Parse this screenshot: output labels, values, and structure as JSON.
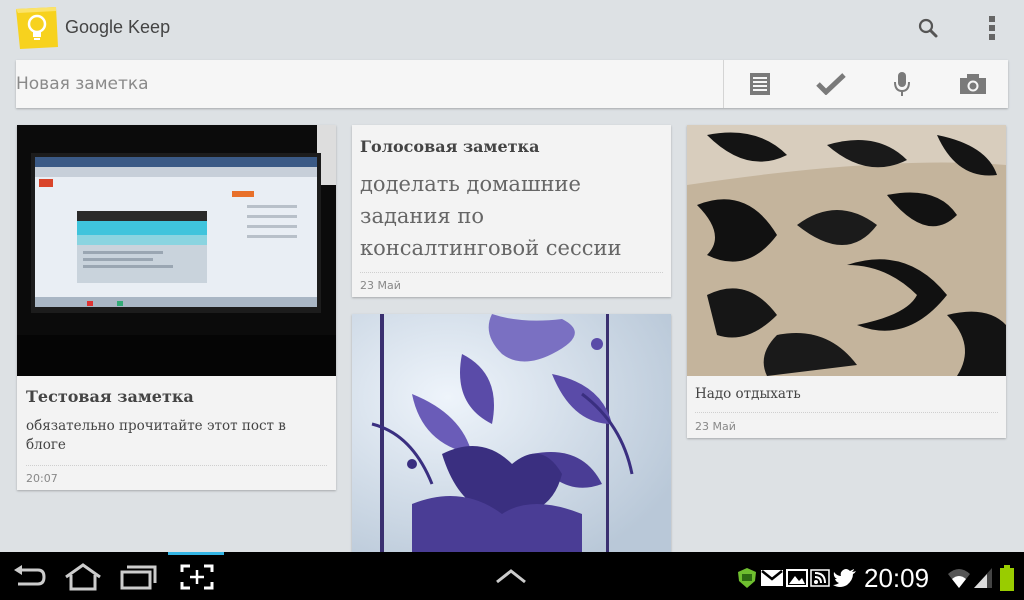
{
  "app": {
    "title": "Google Keep"
  },
  "new_note": {
    "placeholder": "Новая заметка"
  },
  "notes": [
    {
      "title": "Тестовая заметка",
      "body": "обязательно прочитайте этот пост в блоге",
      "date": "20:07"
    },
    {
      "title": "Голосовая заметка",
      "body": "доделать домашние задания по консалтинговой сессии",
      "date": "23 Май"
    },
    {
      "body": "Надо отдыхать",
      "date": "23 Май"
    }
  ],
  "status_bar": {
    "time": "20:09"
  },
  "colors": {
    "background": "#dde1e4",
    "card": "#f3f3f3",
    "accent": "#33b5e5",
    "logo": "#f7d21e"
  }
}
